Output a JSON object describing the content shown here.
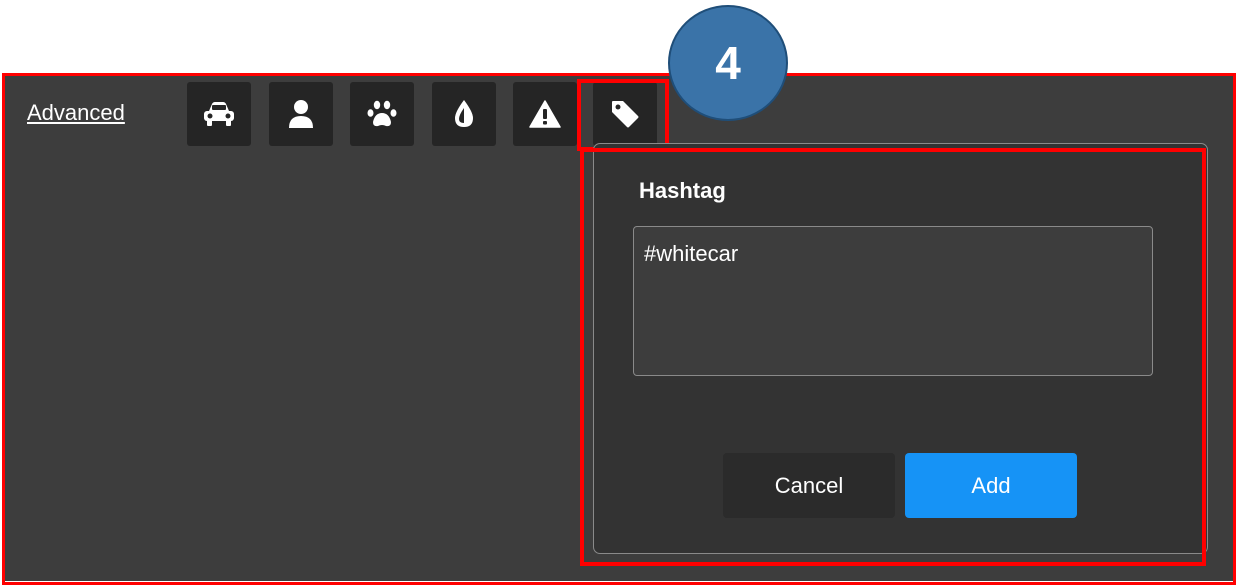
{
  "toolbar": {
    "advanced_label": "Advanced",
    "icons": [
      "car-icon",
      "person-icon",
      "paw-icon",
      "drop-icon",
      "warning-icon",
      "tag-icon"
    ]
  },
  "annotation": {
    "step_number": "4",
    "step_color": "#3a73a8",
    "highlight_color": "#ff0000"
  },
  "hashtag_dialog": {
    "title": "Hashtag",
    "input_value": "#whitecar",
    "cancel_label": "Cancel",
    "add_label": "Add",
    "add_color": "#1693f6"
  }
}
